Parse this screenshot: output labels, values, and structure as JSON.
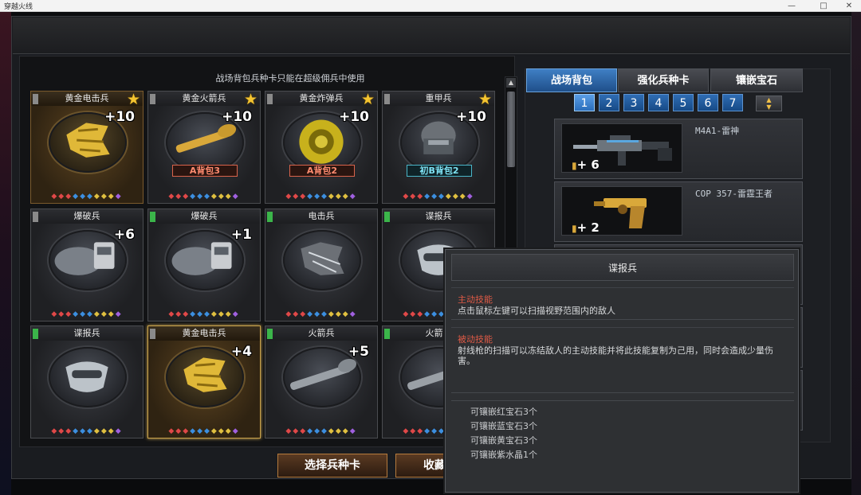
{
  "window": {
    "title": "穿越火线",
    "min": "—",
    "max": "□",
    "close": "✕"
  },
  "hint": "战场背包兵种卡只能在超级佣兵中使用",
  "cards": [
    {
      "name": "黄金电击兵",
      "level": "+10",
      "star": true,
      "pack": "",
      "tag": "gray",
      "gold": true,
      "icon": "golden-claw-icon"
    },
    {
      "name": "黄金火箭兵",
      "level": "+10",
      "star": true,
      "pack": "A背包3",
      "tag": "gray",
      "gold": false,
      "icon": "golden-rocket-icon"
    },
    {
      "name": "黄金炸弹兵",
      "level": "+10",
      "star": true,
      "pack": "A背包2",
      "tag": "gray",
      "gold": false,
      "icon": "golden-bomb-icon"
    },
    {
      "name": "重甲兵",
      "level": "+10",
      "star": true,
      "pack": "初B背包2",
      "tag": "gray",
      "gold": false,
      "icon": "armor-helmet-icon"
    },
    {
      "name": "爆破兵",
      "level": "+6",
      "star": false,
      "pack": "",
      "tag": "gray",
      "gold": false,
      "icon": "c4-explosive-icon"
    },
    {
      "name": "爆破兵",
      "level": "+1",
      "star": false,
      "pack": "",
      "tag": "green",
      "gold": false,
      "icon": "c4-explosive-icon"
    },
    {
      "name": "电击兵",
      "level": "",
      "star": false,
      "pack": "",
      "tag": "green",
      "gold": false,
      "icon": "electric-claw-icon"
    },
    {
      "name": "谍报兵",
      "level": "",
      "star": false,
      "pack": "",
      "tag": "green",
      "gold": false,
      "icon": "spy-mask-icon"
    },
    {
      "name": "谍报兵",
      "level": "",
      "star": false,
      "pack": "",
      "tag": "green",
      "gold": false,
      "icon": "spy-mask-icon"
    },
    {
      "name": "黄金电击兵",
      "level": "+4",
      "star": false,
      "pack": "",
      "tag": "gray",
      "gold": true,
      "icon": "golden-claw-icon",
      "selected": true
    },
    {
      "name": "火箭兵",
      "level": "+5",
      "star": false,
      "pack": "",
      "tag": "green",
      "gold": false,
      "icon": "rocket-launcher-icon"
    },
    {
      "name": "火箭兵",
      "level": "",
      "star": false,
      "pack": "",
      "tag": "green",
      "gold": false,
      "icon": "rocket-launcher-icon"
    }
  ],
  "tabs": [
    "战场背包",
    "强化兵种卡",
    "镶嵌宝石"
  ],
  "pages": [
    "1",
    "2",
    "3",
    "4",
    "5",
    "6",
    "7"
  ],
  "weapons": [
    {
      "name": "M4A1-雷神",
      "count": "6",
      "icon": "assault-rifle-icon"
    },
    {
      "name": "COP 357-雷霆王者",
      "count": "2",
      "icon": "golden-pistol-icon"
    }
  ],
  "tooltip": {
    "title": "谍报兵",
    "active_label": "主动技能",
    "active_text": "点击鼠标左键可以扫描视野范围内的敌人",
    "passive_label": "被动技能",
    "passive_text": "射线枪的扫描可以冻结敌人的主动技能并将此技能复制为己用，同时会造成少量伤害。",
    "sockets": [
      "可镶嵌红宝石3个",
      "可镶嵌蓝宝石3个",
      "可镶嵌黄宝石3个",
      "可镶嵌紫水晶1个"
    ]
  },
  "buttons": {
    "select": "选择兵种卡",
    "collect": "收藏"
  },
  "colors": {
    "accent_blue": "#2f6db4",
    "gold": "#f4c430",
    "red_label": "#e05a46"
  }
}
